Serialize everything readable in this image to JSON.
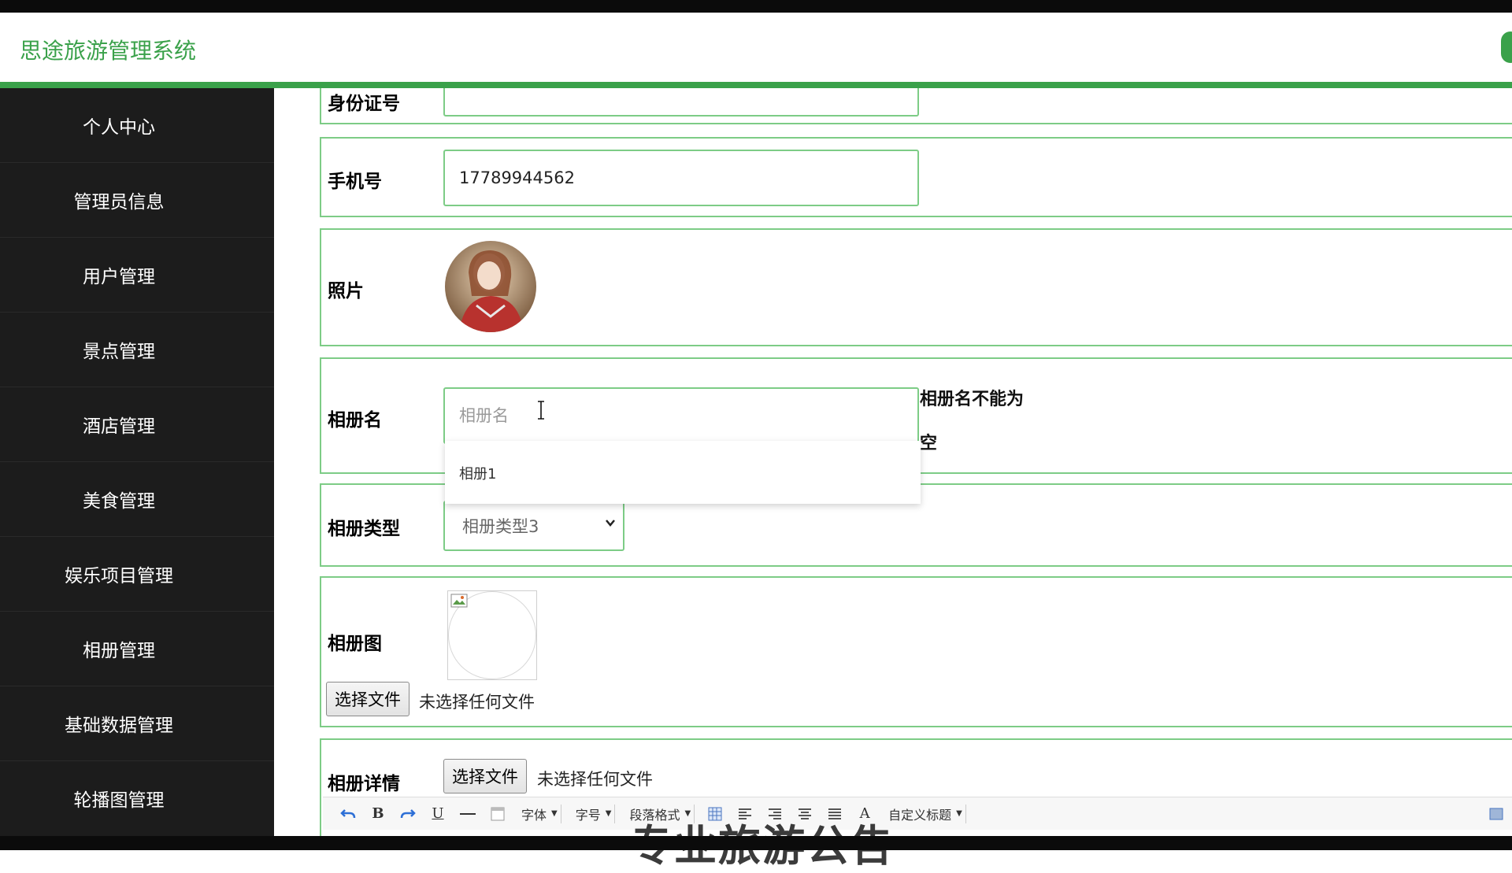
{
  "header": {
    "title": "思途旅游管理系统"
  },
  "sidebar": {
    "items": [
      {
        "label": "个人中心"
      },
      {
        "label": "管理员信息"
      },
      {
        "label": "用户管理"
      },
      {
        "label": "景点管理"
      },
      {
        "label": "酒店管理"
      },
      {
        "label": "美食管理"
      },
      {
        "label": "娱乐项目管理"
      },
      {
        "label": "相册管理"
      },
      {
        "label": "基础数据管理"
      },
      {
        "label": "轮播图管理"
      }
    ]
  },
  "form": {
    "id_card": {
      "label": "身份证号"
    },
    "phone": {
      "label": "手机号",
      "value": "17789944562"
    },
    "photo": {
      "label": "照片"
    },
    "album_name": {
      "label": "相册名",
      "placeholder": "相册名",
      "error": "相册名不能为空",
      "suggestion": "相册1"
    },
    "album_type": {
      "label": "相册类型",
      "selected": "相册类型3"
    },
    "album_image": {
      "label": "相册图",
      "button": "选择文件",
      "status": "未选择任何文件"
    },
    "album_detail": {
      "label": "相册详情",
      "button": "选择文件",
      "status": "未选择任何文件"
    }
  },
  "editor_toolbar": {
    "font_family": "字体",
    "font_size": "字号",
    "paragraph": "段落格式",
    "font_color": "A",
    "custom_title": "自定义标题"
  },
  "watermark": {
    "text": "专业旅游公告"
  },
  "colors": {
    "accent": "#3aa14a",
    "sidebar_bg": "#1c1c1c",
    "border": "#7dcc86"
  }
}
